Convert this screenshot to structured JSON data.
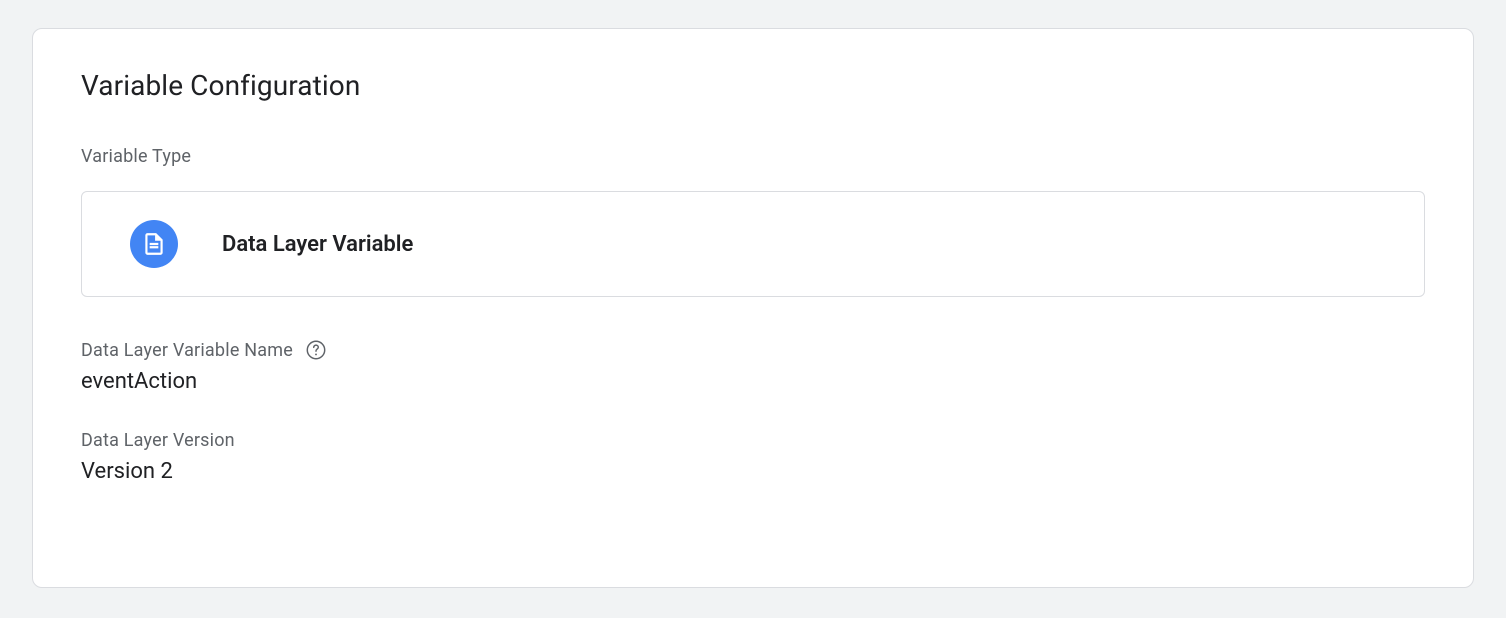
{
  "card": {
    "title": "Variable Configuration"
  },
  "variableType": {
    "label": "Variable Type",
    "name": "Data Layer Variable"
  },
  "variableName": {
    "label": "Data Layer Variable Name",
    "value": "eventAction"
  },
  "version": {
    "label": "Data Layer Version",
    "value": "Version 2"
  }
}
